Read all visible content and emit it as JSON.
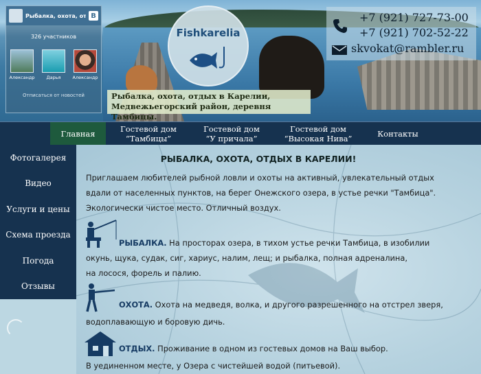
{
  "vk_widget": {
    "group_name": "Рыбалка, охота, от...",
    "badge": "B",
    "members_count": "326 участников",
    "members": [
      {
        "name": "Александр"
      },
      {
        "name": "Дарья"
      },
      {
        "name": "Александр"
      }
    ],
    "unsubscribe": "Отписаться от новостей"
  },
  "logo": {
    "text": "Fishkarelia"
  },
  "header_caption": {
    "line1": "Рыбалка, охота, отдых в Карелии,",
    "line2": "Медвежьегорский район, деревня Тамбицы."
  },
  "contacts": {
    "phone1": "+7 (921) 727-73-00",
    "phone2": "+7 (921) 702-52-22",
    "email": "skvokat@rambler.ru"
  },
  "top_nav": [
    {
      "line1": "Главная",
      "line2": ""
    },
    {
      "line1": "Гостевой дом",
      "line2": "“Тамбицы”"
    },
    {
      "line1": "Гостевой дом",
      "line2": "“У причала”"
    },
    {
      "line1": "Гостевой дом",
      "line2": "“Высокая Нива”"
    },
    {
      "line1": "Контакты",
      "line2": ""
    }
  ],
  "side_nav": [
    "Фотогалерея",
    "Видео",
    "Услуги и цены",
    "Схема проезда",
    "Погода",
    "Отзывы"
  ],
  "content": {
    "title": "РЫБАЛКА, ОХОТА, ОТДЫХ В КАРЕЛИИ!",
    "intro": [
      "    Приглашаем любителей рыбной ловли и охоты на активный, увлекательный отдых",
      "вдали от населенных пунктов, на берег Онежского озера, в устье речки \"Тамбица\".",
      "Экологически чистое место. Отличный воздух."
    ],
    "fishing": {
      "heading": "РЫБАЛКА.",
      "line1": " На просторах озера, в тихом устье речки Тамбица, в изобилии",
      "line2": "окунь, щука, судак, сиг, хариус, налим, лещ; и рыбалка, полная адреналина,",
      "line3": "на лосося, форель и палию."
    },
    "hunting": {
      "heading": "ОХОТА.",
      "line1": " Охота на медведя, волка, и другого разрешенного на отстрел зверя,",
      "line2": "водоплавающую и боровую дичь."
    },
    "rest": {
      "heading": "ОТДЫХ.",
      "line1": " Проживание в одном из гостевых домов на Ваш выбор.",
      "line2": "В уединенном месте, у Озера с чистейшей водой (питьевой)."
    }
  }
}
